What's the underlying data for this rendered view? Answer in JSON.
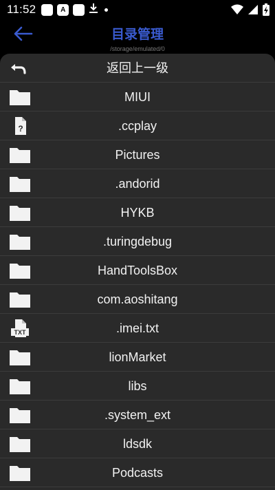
{
  "status": {
    "time": "11:52"
  },
  "header": {
    "title": "目录管理",
    "path": "/storage/emulated/0"
  },
  "rows": [
    {
      "label": "返回上一级",
      "icon": "back-icon"
    },
    {
      "label": "MIUI",
      "icon": "folder-icon"
    },
    {
      "label": ".ccplay",
      "icon": "unknown-file-icon"
    },
    {
      "label": "Pictures",
      "icon": "folder-icon"
    },
    {
      "label": ".andorid",
      "icon": "folder-icon"
    },
    {
      "label": "HYKB",
      "icon": "folder-icon"
    },
    {
      "label": ".turingdebug",
      "icon": "folder-icon"
    },
    {
      "label": "HandToolsBox",
      "icon": "folder-icon"
    },
    {
      "label": "com.aoshitang",
      "icon": "folder-icon"
    },
    {
      "label": ".imei.txt",
      "icon": "txt-file-icon"
    },
    {
      "label": "lionMarket",
      "icon": "folder-icon"
    },
    {
      "label": "libs",
      "icon": "folder-icon"
    },
    {
      "label": ".system_ext",
      "icon": "folder-icon"
    },
    {
      "label": "ldsdk",
      "icon": "folder-icon"
    },
    {
      "label": "Podcasts",
      "icon": "folder-icon"
    }
  ],
  "txt_icon_text": "TXT",
  "unknown_icon_text": "?",
  "colors": {
    "title": "#3a5bd0",
    "back_arrow": "#3a5bd0",
    "panel": "#2a2a2a"
  }
}
